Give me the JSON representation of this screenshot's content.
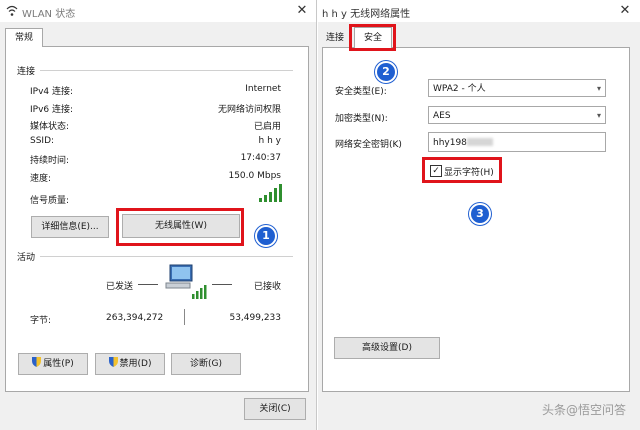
{
  "left_window": {
    "title": "WLAN 状态",
    "tab_general": "常规",
    "connection": {
      "heading": "连接",
      "rows": [
        {
          "label": "IPv4 连接:",
          "value": "Internet"
        },
        {
          "label": "IPv6 连接:",
          "value": "无网络访问权限"
        },
        {
          "label": "媒体状态:",
          "value": "已启用"
        },
        {
          "label": "SSID:",
          "value": "h h y"
        },
        {
          "label": "持续时间:",
          "value": "17:40:37"
        },
        {
          "label": "速度:",
          "value": "150.0 Mbps"
        },
        {
          "label": "信号质量:",
          "value": ""
        }
      ],
      "signal_bars": 5
    },
    "details_button": "详细信息(E)...",
    "wireless_props_button": "无线属性(W)",
    "activity": {
      "heading": "活动",
      "sent_label": "已发送",
      "received_label": "已接收",
      "bytes_label": "字节:",
      "bytes_sent": "263,394,272",
      "bytes_received": "53,499,233"
    },
    "properties_button": "属性(P)",
    "disable_button": "禁用(D)",
    "diagnose_button": "诊断(G)",
    "close_button": "关闭(C)"
  },
  "right_window": {
    "title": "h h y 无线网络属性",
    "tab_connection": "连接",
    "tab_security": "安全",
    "security_type_label": "安全类型(E):",
    "security_type_value": "WPA2 - 个人",
    "encryption_type_label": "加密类型(N):",
    "encryption_type_value": "AES",
    "key_label": "网络安全密钥(K)",
    "key_value": "hhy198",
    "show_chars_label": "显示字符(H)",
    "show_chars_checked": true,
    "advanced_button": "高级设置(D)"
  },
  "annotations": {
    "badge_1": "1",
    "badge_2": "2",
    "badge_3": "3",
    "color": "#e0141b",
    "badge_color": "#1f5fd1"
  },
  "watermark": "头条@悟空问答",
  "icons": [
    "close-icon",
    "signal-strength-icon",
    "network-computer-icon",
    "shield-icon",
    "checkbox-icon",
    "chevron-down-icon"
  ]
}
